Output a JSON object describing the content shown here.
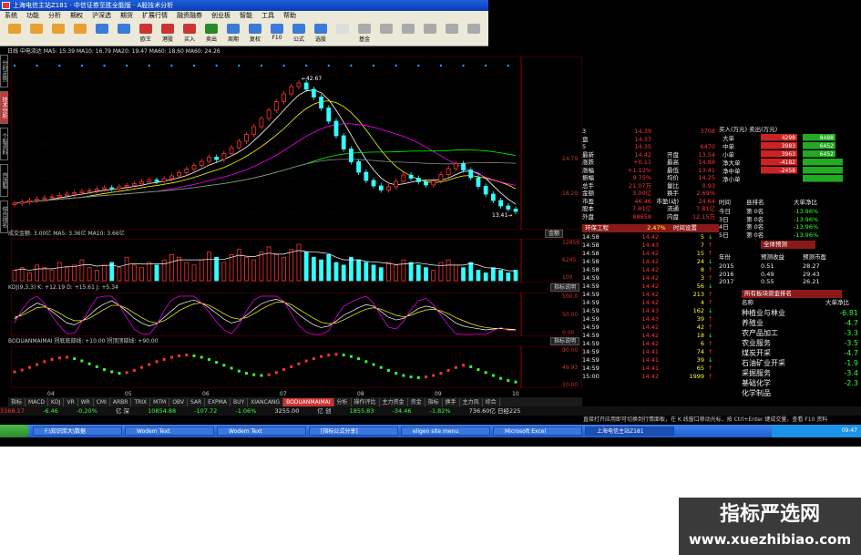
{
  "window": {
    "title": "上海电信主站Z181 · 中信证券至胜全能版 · A股技术分析"
  },
  "menu": [
    "系统",
    "功能",
    "分析",
    "期权",
    "沪深选",
    "期货",
    "扩展行情",
    "融资融券",
    "创业板",
    "智能",
    "工具",
    "帮助"
  ],
  "toolbar": [
    "",
    "",
    "",
    "",
    "",
    "",
    "欧王",
    "港股",
    "买入",
    "卖出",
    "周期",
    "复权",
    "F10",
    "公式",
    "选股",
    "",
    "基金",
    "",
    "",
    "",
    "",
    ""
  ],
  "chart_header": "日线  中电流达 MA5: 15.39  MA10: 16.79  MA20: 19.47  MA60: 18.60  MA60: 24.26",
  "price_labels": {
    "high": "42.67",
    "low": "13.41",
    "right_axis": [
      "24.79",
      "18.29"
    ]
  },
  "left_tabs": [
    "分时走势",
    "技术分析",
    "个股资料",
    "自选股",
    "综合排名"
  ],
  "volume_header": "成交金额: 3.00亿  MA5: 3.36亿  MA10: 3.66亿",
  "volume_axis": [
    "12858",
    "6245",
    "100"
  ],
  "volume_badge": "金额",
  "kdj_header": "KDJ(9,3,3) K: +12.19  D: +15.61  J: +5.34",
  "kdj_axis": [
    "100.0",
    "50.00",
    "0.00"
  ],
  "kdj_badge": "指标说明",
  "bodu_header": "BODUANMAIMAI 拐底底部线: +10.00  拐顶顶部线: +90.00",
  "bodu_axis": [
    "90.00",
    "49.93",
    "10.00"
  ],
  "bodu_badge": "指标说明",
  "x_axis": [
    "04",
    "05",
    "06",
    "07",
    "08",
    "09",
    "10"
  ],
  "bottom_tabs": [
    "指标",
    "MACD",
    "KDJ",
    "VR",
    "WR",
    "CMI",
    "ARBR",
    "TRIX",
    "MTM",
    "OBV",
    "SAR",
    "EXPMA",
    "BUY",
    "XIANCANG",
    "BODUANMAIMAI",
    "分析",
    "操作评比",
    "主力资金",
    "资金",
    "指标",
    "换手",
    "主力风",
    "综合"
  ],
  "status": {
    "sh": "3168.17",
    "sh_chg": "-6.46",
    "sh_pct": "-0.20%",
    "label_sz": "亿 深",
    "sz": "10854.88",
    "sz_chg": "-107.72",
    "sz_pct": "-1.06%",
    "label_cy": "亿 创",
    "cy_amt": "3255.00",
    "cy": "1855.83",
    "cy_chg": "-34.46",
    "cy_pct": "-1.82%",
    "misc": "736.60亿 日经225"
  },
  "bottom_hint": "直接打开应用即可切换到行情面板，在 K 线窗口移动光标，按 Ctrl+Enter 键成交量，查看 F10 资料",
  "quote_panel": {
    "rows": [
      {
        "label": "3",
        "v1": "14.39",
        "v2": "",
        "v3": "3708"
      },
      {
        "label": "盘",
        "v1": "14.37",
        "v2": "",
        "v3": ""
      },
      {
        "label": "5",
        "v1": "14.35",
        "v2": "",
        "v3": "6470"
      },
      {
        "label": "最新",
        "v1": "14.42",
        "v2": "开盘",
        "v3": "13.54"
      },
      {
        "label": "涨跌",
        "v1": "+0.11",
        "v2": "最高",
        "v3": "14.88"
      },
      {
        "label": "涨幅",
        "v1": "+1.12%",
        "v2": "最低",
        "v3": "13.41"
      },
      {
        "label": "振幅",
        "v1": "9.75%",
        "v2": "均价",
        "v3": "14.25"
      },
      {
        "label": "总手",
        "v1": "21.07万",
        "v2": "量比",
        "v3": "0.93"
      },
      {
        "label": "金额",
        "v1": "3.00亿",
        "v2": "换手",
        "v3": "2.69%"
      },
      {
        "label": "市盈",
        "v1": "46.46",
        "v2": "市盈(动)",
        "v3": "24.64"
      },
      {
        "label": "股本",
        "v1": "7.81亿",
        "v2": "流通",
        "v3": "7.81亿"
      },
      {
        "label": "外盘",
        "v1": "88658",
        "v2": "内盘",
        "v3": "12.15万"
      }
    ],
    "industry": "环保工程",
    "industry_pct": "2.47%",
    "industry_btn": "时间设置"
  },
  "ticks": [
    {
      "t": "14:58",
      "p": "14.42",
      "v": "5"
    },
    {
      "t": "14:58",
      "p": "14.43",
      "v": "7"
    },
    {
      "t": "14:58",
      "p": "14.42",
      "v": "15"
    },
    {
      "t": "14:58",
      "p": "14.42",
      "v": "24"
    },
    {
      "t": "14:58",
      "p": "14.42",
      "v": "8"
    },
    {
      "t": "14:59",
      "p": "14.42",
      "v": "3"
    },
    {
      "t": "14:59",
      "p": "14.42",
      "v": "56"
    },
    {
      "t": "14:59",
      "p": "14.42",
      "v": "213"
    },
    {
      "t": "14:59",
      "p": "14.42",
      "v": "4"
    },
    {
      "t": "14:59",
      "p": "14.43",
      "v": "162"
    },
    {
      "t": "14:59",
      "p": "14.43",
      "v": "39"
    },
    {
      "t": "14:59",
      "p": "14.42",
      "v": "42"
    },
    {
      "t": "14:59",
      "p": "14.42",
      "v": "18"
    },
    {
      "t": "14:59",
      "p": "14.42",
      "v": "6"
    },
    {
      "t": "14:59",
      "p": "14.41",
      "v": "74"
    },
    {
      "t": "14:59",
      "p": "14.41",
      "v": "39"
    },
    {
      "t": "14:59",
      "p": "14.41",
      "v": "65"
    },
    {
      "t": "15:00",
      "p": "14.42",
      "v": "1999"
    }
  ],
  "flow_panel": {
    "header": "买入(万元) 卖出(万元)",
    "rows": [
      {
        "label": "大单",
        "buy": "4298",
        "sell": "8488"
      },
      {
        "label": "中单",
        "buy": "3983",
        "sell": "6452"
      },
      {
        "label": "小单",
        "buy": "3963",
        "sell": "6452"
      },
      {
        "label": "净大单",
        "buy": "-4182",
        "sell": ""
      },
      {
        "label": "净中单",
        "buy": "-2458",
        "sell": ""
      },
      {
        "label": "净小单",
        "buy": "",
        "sell": ""
      }
    ],
    "colors": {
      "buy": "#cc2222",
      "sell": "#22aa22"
    }
  },
  "rank_panel": {
    "headers": [
      "时间",
      "县排名",
      "大单净比"
    ],
    "rows": [
      {
        "k": "今日",
        "r": "第  0名",
        "v": "-13.96%"
      },
      {
        "k": "3日",
        "r": "第  0名",
        "v": "-13.96%"
      },
      {
        "k": "4日",
        "r": "第  0名",
        "v": "-13.96%"
      },
      {
        "k": "5日",
        "r": "第  0名",
        "v": "-13.96%"
      }
    ]
  },
  "forecast": {
    "tab": "全体预测",
    "headers": [
      "年份",
      "预测收益",
      "预测市盈"
    ],
    "rows": [
      {
        "y": "2015",
        "a": "0.51",
        "b": "28.27"
      },
      {
        "y": "2016",
        "a": "0.49",
        "b": "29.43"
      },
      {
        "y": "2017",
        "a": "0.55",
        "b": "26.21"
      }
    ]
  },
  "sector": {
    "title": "所有板块资金排名",
    "headers": [
      "名称",
      "大单净比"
    ],
    "rows": [
      {
        "n": "种植业与林业",
        "v": "-6.81"
      },
      {
        "n": "养殖业",
        "v": "-4.7"
      },
      {
        "n": "农产品加工",
        "v": "-3.3"
      },
      {
        "n": "农业服务",
        "v": "-3.5"
      },
      {
        "n": "煤炭开采",
        "v": "-4.7"
      },
      {
        "n": "石油矿业开采",
        "v": "-1.9"
      },
      {
        "n": "采掘服务",
        "v": "-3.4"
      },
      {
        "n": "基础化学",
        "v": "-2.3"
      },
      {
        "n": "化学制品",
        "v": ""
      }
    ]
  },
  "taskbar": {
    "items": [
      "F:\\知识库大\\数据",
      "Wodem Text",
      "Wodem Text",
      "[指标公式分享]",
      "eligen site menu",
      "Microsoft Excel",
      "上海电信主站Z181"
    ],
    "time": "09:47"
  },
  "watermark": {
    "line1": "指标严选网",
    "line2": "www.xuezhibiao.com"
  },
  "chart_data": {
    "type": "candlestick",
    "title": "",
    "x": [
      "04",
      "05",
      "06",
      "07",
      "08",
      "09",
      "10"
    ],
    "ylim": [
      12,
      44
    ],
    "closes": [
      16.2,
      16.5,
      16.8,
      17.1,
      17.4,
      17.6,
      17.9,
      18.2,
      18.5,
      18.8,
      19.0,
      19.3,
      19.6,
      19.4,
      19.8,
      20.1,
      20.5,
      20.9,
      21.3,
      21.0,
      21.6,
      22.2,
      22.9,
      23.7,
      24.5,
      25.4,
      26.3,
      25.8,
      27.1,
      28.4,
      29.8,
      31.3,
      33.0,
      34.8,
      36.6,
      38.5,
      40.2,
      41.8,
      42.6,
      41.2,
      39.5,
      37.1,
      34.2,
      31.0,
      28.1,
      25.3,
      23.0,
      21.2,
      20.0,
      19.1,
      19.8,
      21.0,
      22.4,
      21.7,
      20.9,
      20.2,
      21.1,
      22.5,
      23.8,
      24.9,
      23.5,
      21.8,
      19.9,
      18.2,
      16.8,
      15.6,
      14.9,
      14.4
    ],
    "volumes": [
      4,
      5,
      3,
      6,
      5,
      4,
      7,
      5,
      6,
      8,
      5,
      4,
      6,
      7,
      5,
      9,
      6,
      5,
      7,
      6,
      8,
      10,
      9,
      7,
      6,
      8,
      11,
      9,
      7,
      10,
      12,
      9,
      8,
      11,
      13,
      10,
      9,
      12,
      14,
      11,
      9,
      8,
      10,
      7,
      6,
      9,
      8,
      7,
      6,
      5,
      7,
      6,
      8,
      7,
      6,
      5,
      4,
      7,
      8,
      6,
      5,
      7,
      4,
      3,
      5,
      4,
      3,
      4
    ],
    "kdj_k": [
      40,
      55,
      70,
      82,
      75,
      60,
      45,
      30,
      25,
      35,
      50,
      68,
      80,
      88,
      76,
      60,
      42,
      30,
      22,
      28,
      45,
      62,
      78,
      85,
      90,
      82,
      70,
      55,
      40,
      30,
      35,
      50,
      66,
      80,
      88,
      92,
      85,
      70,
      52,
      38,
      25,
      18,
      22,
      35,
      50,
      60,
      70,
      78,
      74,
      60,
      45,
      38,
      42,
      55,
      68,
      74,
      70,
      58,
      44,
      30,
      22,
      18,
      15,
      12,
      14,
      16,
      13,
      12
    ],
    "kdj_d": [
      45,
      50,
      60,
      70,
      72,
      66,
      56,
      44,
      36,
      36,
      42,
      54,
      66,
      76,
      76,
      68,
      56,
      44,
      34,
      30,
      36,
      48,
      62,
      72,
      80,
      82,
      76,
      66,
      54,
      44,
      40,
      44,
      54,
      66,
      76,
      84,
      84,
      78,
      66,
      54,
      42,
      32,
      28,
      30,
      38,
      48,
      58,
      66,
      70,
      66,
      58,
      50,
      46,
      50,
      58,
      64,
      66,
      62,
      54,
      44,
      36,
      28,
      22,
      18,
      16,
      15,
      14,
      13
    ],
    "bodu": [
      40,
      45,
      52,
      60,
      68,
      74,
      78,
      80,
      76,
      70,
      62,
      54,
      46,
      40,
      36,
      38,
      44,
      52,
      60,
      68,
      74,
      80,
      84,
      86,
      84,
      80,
      74,
      66,
      58,
      50,
      42,
      36,
      32,
      30,
      32,
      38,
      46,
      54,
      62,
      70,
      76,
      82,
      86,
      88,
      86,
      82,
      76,
      68,
      60,
      52,
      44,
      36,
      30,
      26,
      24,
      26,
      30,
      36,
      44,
      52,
      58,
      54,
      46,
      38,
      30,
      22,
      16,
      12
    ]
  }
}
